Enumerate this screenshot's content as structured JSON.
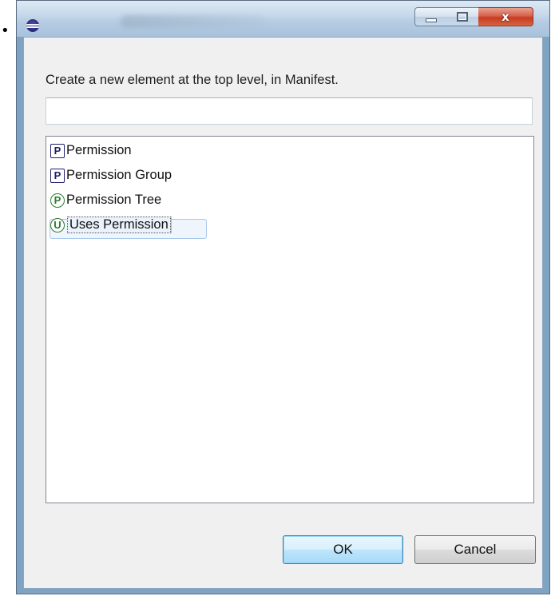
{
  "window": {
    "close_glyph": "x"
  },
  "dialog": {
    "message": "Create a new element at the top level, in Manifest.",
    "filter": {
      "value": "",
      "placeholder": ""
    },
    "elements": [
      {
        "icon_letter": "P",
        "icon_shape": "square",
        "icon_color": "#1d1f6b",
        "label": "Permission",
        "selected": false
      },
      {
        "icon_letter": "P",
        "icon_shape": "square",
        "icon_color": "#1d1f6b",
        "label": "Permission Group",
        "selected": false
      },
      {
        "icon_letter": "P",
        "icon_shape": "circle",
        "icon_color": "#2f7d2f",
        "label": "Permission Tree",
        "selected": false
      },
      {
        "icon_letter": "U",
        "icon_shape": "circle",
        "icon_color": "#2f7d2f",
        "label": "Uses Permission",
        "selected": true
      }
    ],
    "buttons": {
      "ok": "OK",
      "cancel": "Cancel"
    }
  }
}
